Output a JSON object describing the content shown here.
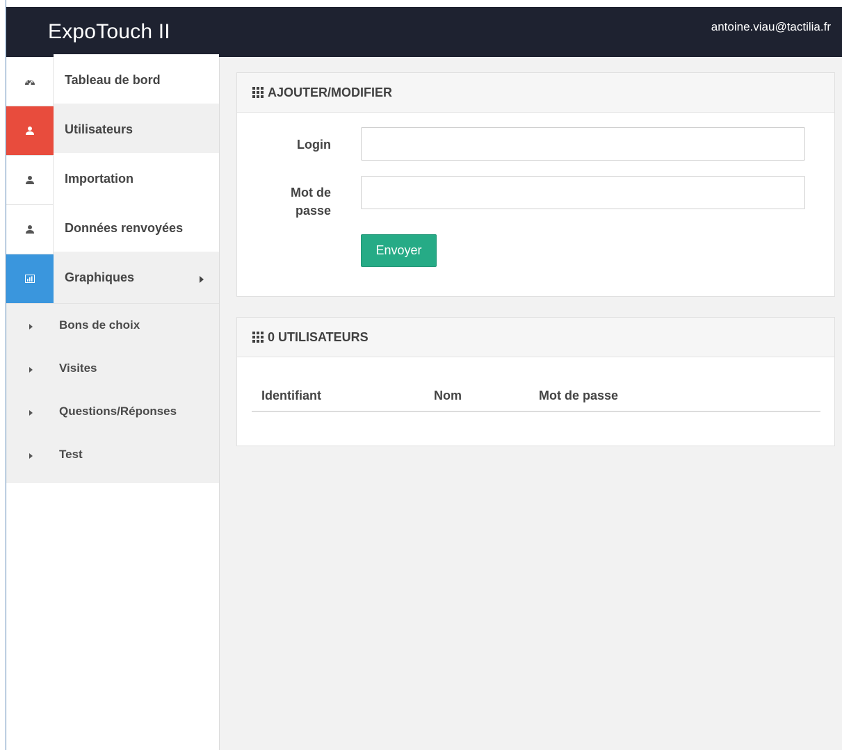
{
  "app": {
    "title": "ExpoTouch II",
    "user_email": "antoine.viau@tactilia.fr"
  },
  "sidebar": {
    "items": [
      {
        "label": "Tableau de bord",
        "icon": "dashboard-icon",
        "state": "normal"
      },
      {
        "label": "Utilisateurs",
        "icon": "user-icon",
        "state": "active"
      },
      {
        "label": "Importation",
        "icon": "user-icon",
        "state": "normal"
      },
      {
        "label": "Données renvoyées",
        "icon": "user-icon",
        "state": "normal"
      },
      {
        "label": "Graphiques",
        "icon": "bar-chart-icon",
        "state": "open"
      }
    ],
    "submenu": [
      {
        "label": "Bons de choix"
      },
      {
        "label": "Visites"
      },
      {
        "label": "Questions/Réponses"
      },
      {
        "label": "Test"
      }
    ]
  },
  "form_panel": {
    "title": "AJOUTER/MODIFIER",
    "login_label": "Login",
    "login_value": "",
    "password_label_line1": "Mot de",
    "password_label_line2": "passe",
    "password_value": "",
    "submit_label": "Envoyer"
  },
  "users_panel": {
    "title": "0 UTILISATEURS",
    "columns": [
      "Identifiant",
      "Nom",
      "Mot de passe"
    ]
  },
  "colors": {
    "topbar": "#1e2230",
    "active": "#e84c3d",
    "open": "#3a96dd",
    "button": "#26ab86"
  }
}
